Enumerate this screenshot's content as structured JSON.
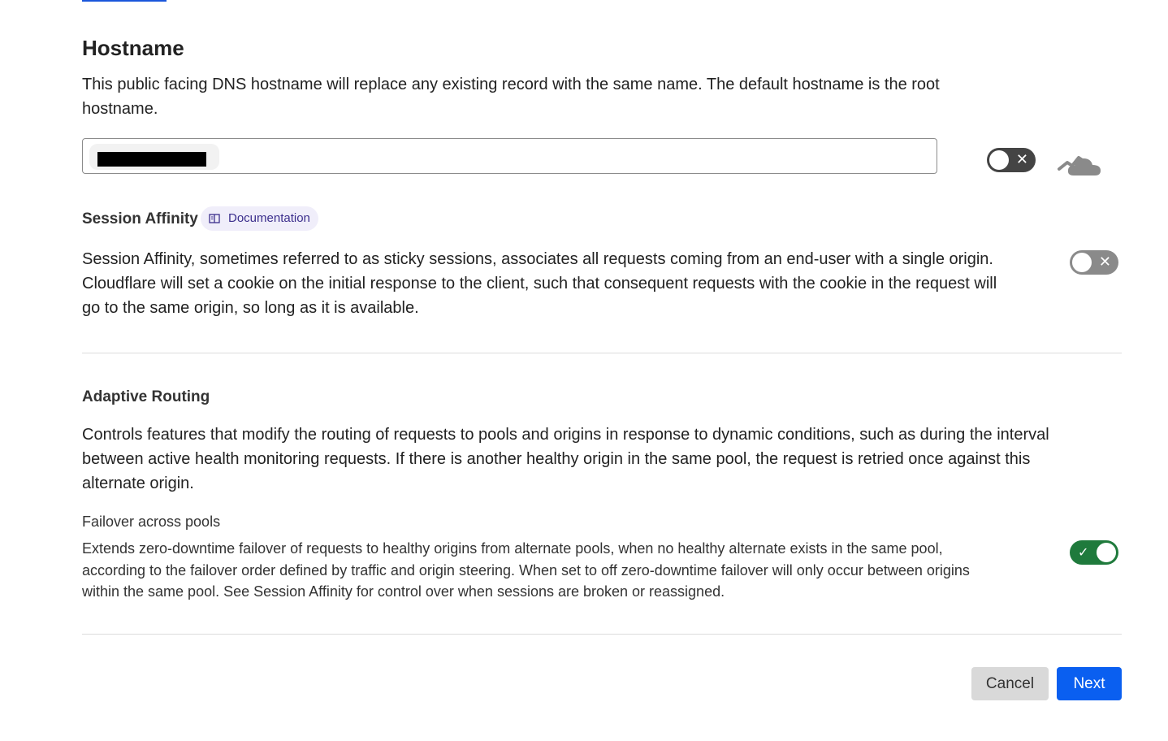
{
  "hostname": {
    "title": "Hostname",
    "description": "This public facing DNS hostname will replace any existing record with the same name. The default hostname is the root hostname.",
    "input_value": "",
    "proxy_toggle": {
      "state": "off"
    },
    "proxy_icon": "cloud-dns-only-icon"
  },
  "session_affinity": {
    "title": "Session Affinity",
    "doc_badge": "Documentation",
    "doc_icon": "book-icon",
    "description": "Session Affinity, sometimes referred to as sticky sessions, associates all requests coming from an end-user with a single origin. Cloudflare will set a cookie on the initial response to the client, such that consequent requests with the cookie in the request will go to the same origin, so long as it is available.",
    "toggle": {
      "state": "off"
    }
  },
  "adaptive_routing": {
    "title": "Adaptive Routing",
    "description": "Controls features that modify the routing of requests to pools and origins in response to dynamic conditions, such as during the interval between active health monitoring requests. If there is another healthy origin in the same pool, the request is retried once against this alternate origin.",
    "failover": {
      "title": "Failover across pools",
      "description": "Extends zero-downtime failover of requests to healthy origins from alternate pools, when no healthy alternate exists in the same pool, according to the failover order defined by traffic and origin steering. When set to off zero-downtime failover will only occur between origins within the same pool. See Session Affinity for control over when sessions are broken or reassigned.",
      "toggle": {
        "state": "on"
      }
    }
  },
  "actions": {
    "cancel_label": "Cancel",
    "next_label": "Next"
  },
  "colors": {
    "primary": "#0a5ff0",
    "toggle_on": "#1f7a3c",
    "badge_bg": "#f0eefa"
  }
}
